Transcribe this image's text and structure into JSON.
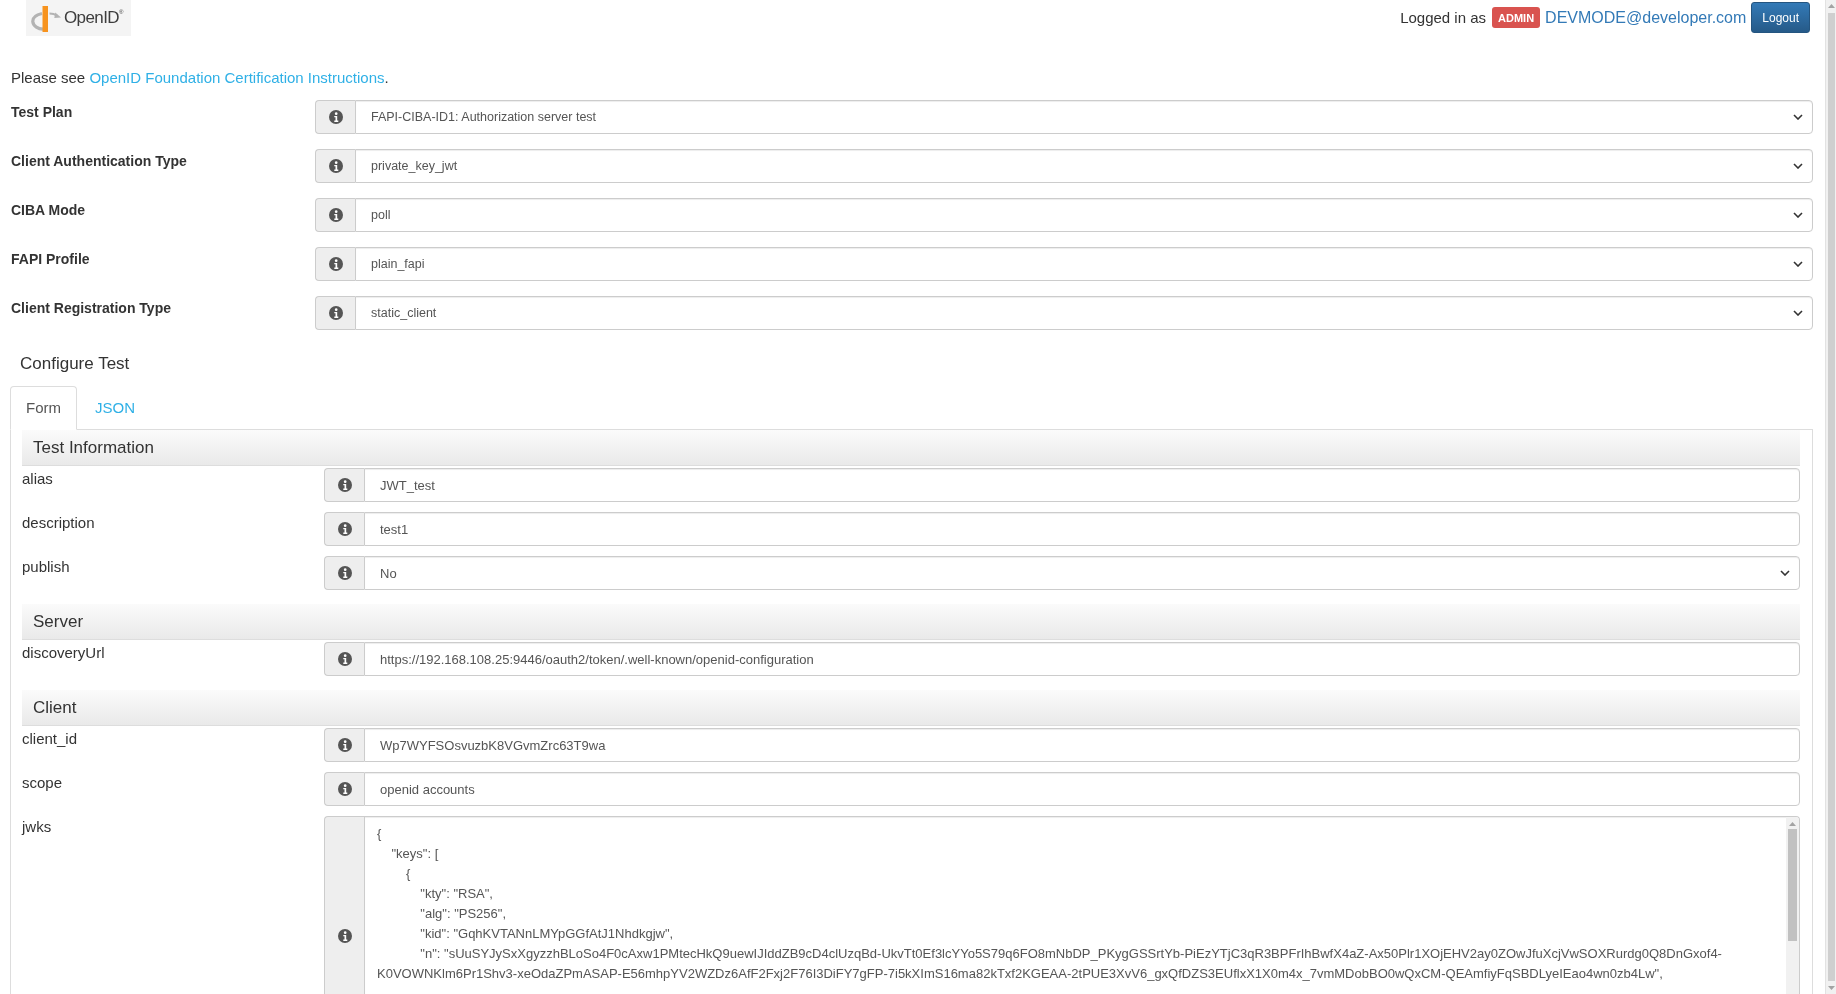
{
  "header": {
    "logo_text": "OpenID$^{®}$",
    "logged_in_label": "Logged in as",
    "role_badge": "ADMIN",
    "user_email": "DEVMODE@developer.com",
    "logout_button": "Logout"
  },
  "notice": {
    "text": "Please see ",
    "link": "OpenID Foundation Certification Instructions",
    "suffix": "."
  },
  "plan_fields": [
    {
      "label": "Test Plan",
      "value": "FAPI-CIBA-ID1: Authorization server test"
    },
    {
      "label": "Client Authentication Type",
      "value": "private_key_jwt"
    },
    {
      "label": "CIBA Mode",
      "value": "poll"
    },
    {
      "label": "FAPI Profile",
      "value": "plain_fapi"
    },
    {
      "label": "Client Registration Type",
      "value": "static_client"
    }
  ],
  "configure_test": {
    "title": "Configure Test",
    "tabs": [
      {
        "label": "Form",
        "selected": true
      },
      {
        "label": "JSON",
        "selected": false
      }
    ],
    "sections": [
      {
        "title": "Test Information",
        "fields": [
          {
            "label": "alias",
            "kind": "text",
            "value": "JWT_test"
          },
          {
            "label": "description",
            "kind": "text",
            "value": "test1"
          },
          {
            "label": "publish",
            "kind": "select",
            "value": "No"
          }
        ]
      },
      {
        "title": "Server",
        "fields": [
          {
            "label": "discoveryUrl",
            "kind": "text",
            "value": "https://192.168.108.25:9446/oauth2/token/.well-known/openid-configuration"
          }
        ]
      },
      {
        "title": "Client",
        "fields": [
          {
            "label": "client_id",
            "kind": "text",
            "value": "Wp7WYFSOsvuzbK8VGvmZrc63T9wa"
          },
          {
            "label": "scope",
            "kind": "text",
            "value": "openid accounts"
          },
          {
            "label": "jwks",
            "kind": "textarea",
            "value": "{\n    \"keys\": [\n        {\n            \"kty\": \"RSA\",\n            \"alg\": \"PS256\",\n            \"kid\": \"GqhKVTANnLMYpGGfAtJ1Nhdkgjw\",\n            \"n\": \"sUuSYJySxXgyzzhBLoSo4F0cAxw1PMtecHkQ9uewIJIddZB9cD4clUzqBd-UkvTt0Ef3lcYYo5S79q6FO8mNbDP_PKygGSSrtYb-PiEzYTjC3qR3BPFrIhBwfX4aZ-Ax50Plr1XOjEHV2ay0ZOwJfuXcjVwSOXRurdg0Q8DnGxof4-K0VOWNKlm6Pr1Shv3-xeOdaZPmASAP-E56mhpYV2WZDz6AfF2Fxj2F76I3DiFY7gFP-7i5kXImS16ma82kTxf2KGEAA-2tPUE3XvV6_gxQfDZS3EUflxX1X0m4x_7vmMDobBO0wQxCM-QEAmfiyFqSBDLyeIEao4wn0zb4Lw\","
          }
        ]
      }
    ]
  }
}
